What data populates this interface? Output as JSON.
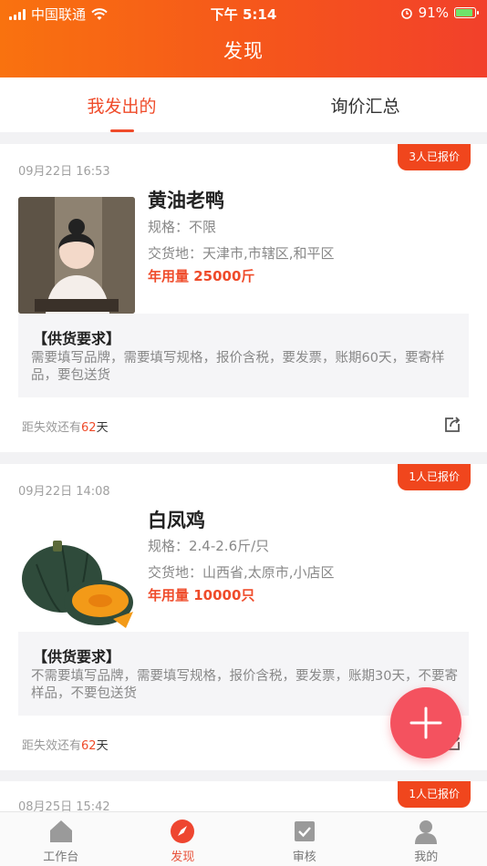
{
  "status_bar": {
    "carrier": "中国联通",
    "time": "下午 5:14",
    "battery": "91%"
  },
  "header": {
    "title": "发现"
  },
  "tabs": [
    {
      "label": "我发出的"
    },
    {
      "label": "询价汇总"
    }
  ],
  "cards": [
    {
      "date": "09月22日 16:53",
      "quote_badge": "3人已报价",
      "product_name": "黄油老鸭",
      "spec": "规格：不限",
      "delivery": "交货地：天津市,市辖区,和平区",
      "annual_qty": "年用量 25000斤",
      "req_title": "【供货要求】",
      "req_text": "需要填写品牌，需要填写规格，报价含税，要发票，账期60天，要寄样品，要包送货",
      "expire_prefix": "距失效还有",
      "expire_days": "62",
      "expire_unit": "天"
    },
    {
      "date": "09月22日 14:08",
      "quote_badge": "1人已报价",
      "product_name": "白凤鸡",
      "spec": "规格：2.4-2.6斤/只",
      "delivery": "交货地：山西省,太原市,小店区",
      "annual_qty": "年用量 10000只",
      "req_title": "【供货要求】",
      "req_text": "不需要填写品牌，需要填写规格，报价含税，要发票，账期30天，不要寄样品，不要包送货",
      "expire_prefix": "距失效还有",
      "expire_days": "62",
      "expire_unit": "天"
    },
    {
      "date": "08月25日 15:42",
      "quote_badge": "1人已报价"
    }
  ],
  "bottom_nav": [
    {
      "label": "工作台",
      "icon": "home-icon"
    },
    {
      "label": "发现",
      "icon": "compass-icon"
    },
    {
      "label": "审核",
      "icon": "checkbox-icon"
    },
    {
      "label": "我的",
      "icon": "user-icon"
    }
  ],
  "colors": {
    "accent": "#ef4b2a",
    "header_start": "#f9720f",
    "header_end": "#f2402b",
    "fab": "#f4525f"
  }
}
